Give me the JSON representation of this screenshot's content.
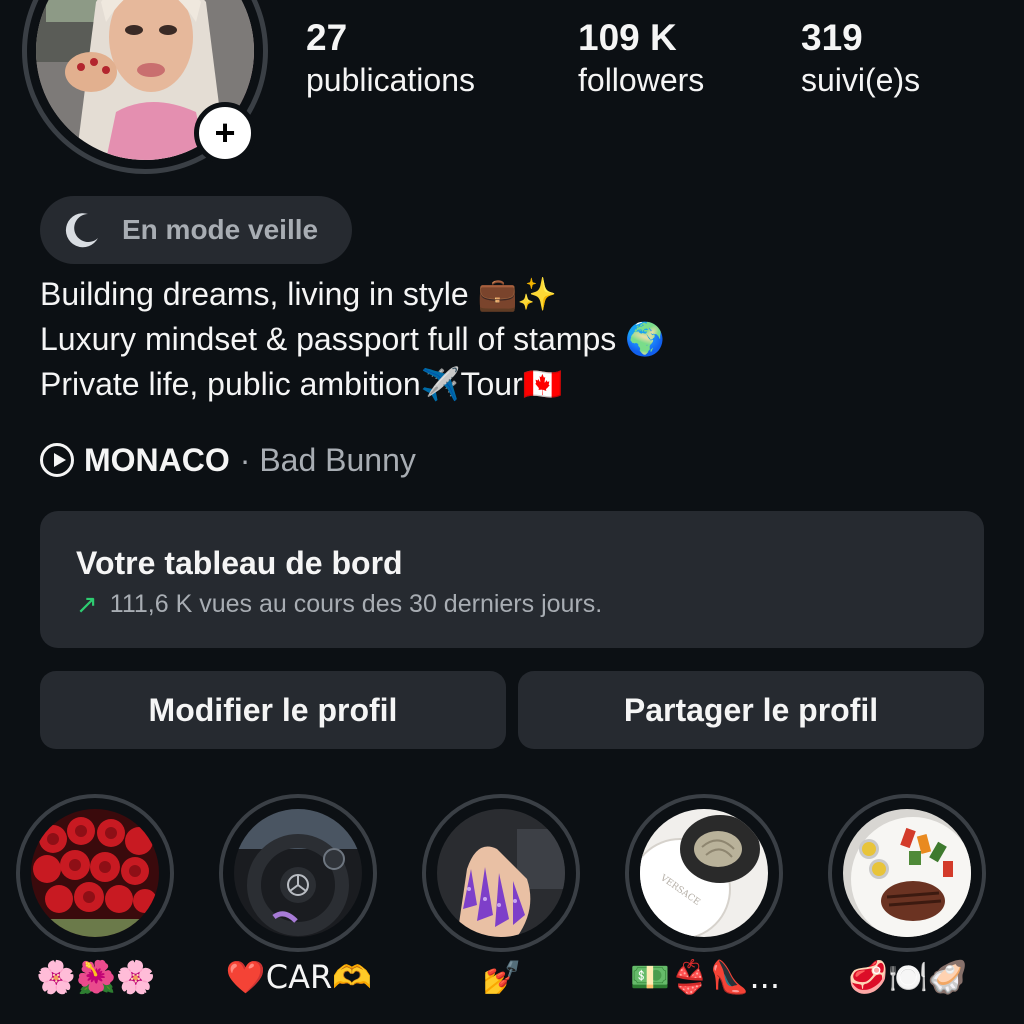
{
  "profile": {
    "stats": [
      {
        "value": "27",
        "label": "publications"
      },
      {
        "value": "109 K",
        "label": "followers"
      },
      {
        "value": "319",
        "label": "suivi(e)s"
      }
    ],
    "status": "En mode veille",
    "bio": [
      "Building dreams, living in style 💼✨",
      "Luxury mindset & passport full of stamps 🌍",
      "Private life, public ambition✈️Tour🇨🇦"
    ],
    "music": {
      "song": "MONACO",
      "artist": "· Bad Bunny"
    }
  },
  "dashboard": {
    "title": "Votre tableau de bord",
    "subtitle": "111,6 K vues au cours des 30 derniers jours."
  },
  "buttons": {
    "edit": "Modifier le profil",
    "share": "Partager le profil"
  },
  "highlights": [
    {
      "caption": "🌸🌺🌸",
      "icon": "roses-image"
    },
    {
      "caption": "❤️CAR🫶",
      "icon": "car-steering-image"
    },
    {
      "caption": "💅",
      "icon": "nails-image"
    },
    {
      "caption": "💵👙👠...",
      "icon": "versace-plate-image"
    },
    {
      "caption": "🥩🍽️🦪",
      "icon": "steak-dinner-image"
    }
  ],
  "colors": {
    "background": "#0c1014",
    "card": "#262a30",
    "ring": "#3a3f45",
    "muted_text": "#a8adb3",
    "trend_green": "#2ecc71"
  }
}
